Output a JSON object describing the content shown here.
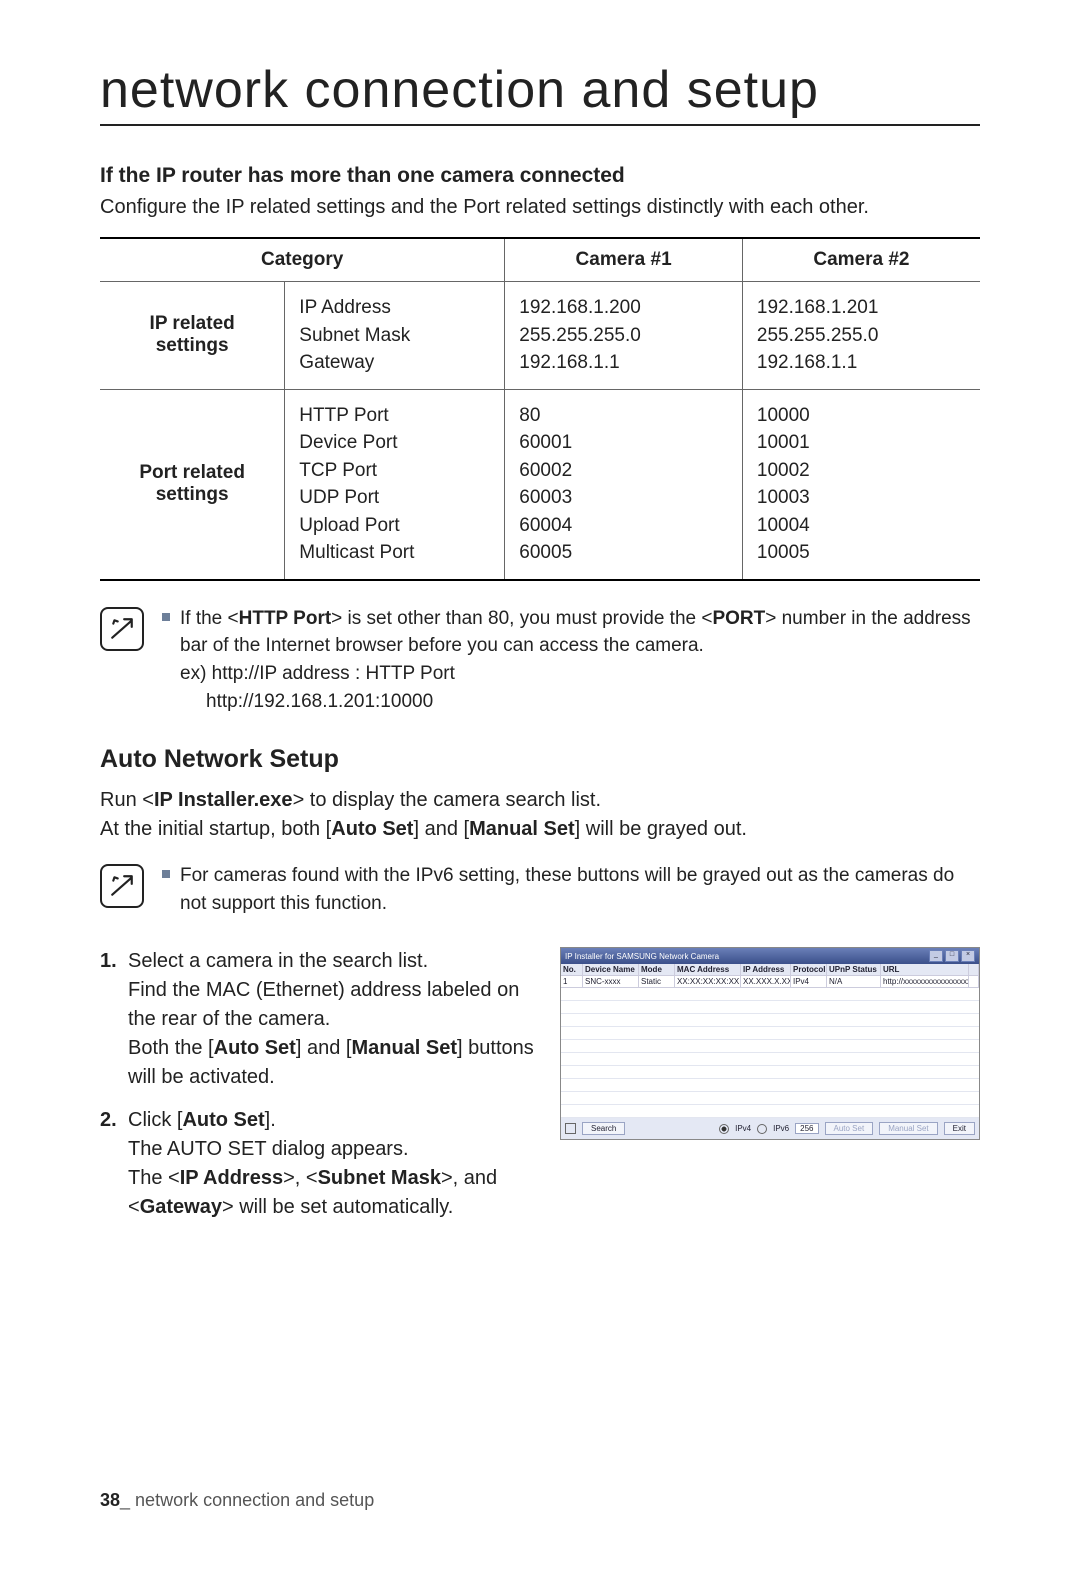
{
  "page_title": "network connection and setup",
  "section1": {
    "heading": "If the IP router has more than one camera connected",
    "intro": "Configure the IP related settings and the Port related settings distinctly with each other."
  },
  "table": {
    "headers": {
      "category": "Category",
      "cam1": "Camera #1",
      "cam2": "Camera #2"
    },
    "rows": [
      {
        "cat": "IP related settings",
        "labels": [
          "IP Address",
          "Subnet Mask",
          "Gateway"
        ],
        "cam1": [
          "192.168.1.200",
          "255.255.255.0",
          "192.168.1.1"
        ],
        "cam2": [
          "192.168.1.201",
          "255.255.255.0",
          "192.168.1.1"
        ]
      },
      {
        "cat": "Port related settings",
        "labels": [
          "HTTP Port",
          "Device Port",
          "TCP Port",
          "UDP Port",
          "Upload Port",
          "Multicast Port"
        ],
        "cam1": [
          "80",
          "60001",
          "60002",
          "60003",
          "60004",
          "60005"
        ],
        "cam2": [
          "10000",
          "10001",
          "10002",
          "10003",
          "10004",
          "10005"
        ]
      }
    ]
  },
  "note1": {
    "line1_a": "If the <",
    "line1_b": "HTTP Port",
    "line1_c": "> is set other than 80, you must provide the <",
    "line1_d": "PORT",
    "line1_e": "> number in the address bar of the Internet browser before you can access the camera.",
    "ex1": "ex) http://IP address : HTTP Port",
    "ex2": "http://192.168.1.201:10000"
  },
  "section2": {
    "heading": "Auto Network Setup",
    "body_a": "Run <",
    "body_b": "IP Installer.exe",
    "body_c": "> to display the camera search list.",
    "body2_a": "At the initial startup, both [",
    "body2_b": "Auto Set",
    "body2_c": "] and [",
    "body2_d": "Manual Set",
    "body2_e": "] will be grayed out."
  },
  "note2": "For cameras found with the IPv6 setting, these buttons will be grayed out as the cameras do not support this function.",
  "steps": [
    {
      "a": "Select a camera in the search list.",
      "b": "Find the MAC (Ethernet) address labeled on the rear of the camera.",
      "c_a": "Both the [",
      "c_b": "Auto Set",
      "c_c": "] and [",
      "c_d": "Manual Set",
      "c_e": "] buttons will be activated."
    },
    {
      "a_a": "Click [",
      "a_b": "Auto Set",
      "a_c": "].",
      "b": "The AUTO SET dialog appears.",
      "c_a": "The <",
      "c_b": "IP Address",
      "c_c": ">, <",
      "c_d": "Subnet Mask",
      "c_e": ">, and <",
      "c_f": "Gateway",
      "c_g": "> will be set automatically."
    }
  ],
  "screenshot": {
    "title": "IP Installer for SAMSUNG Network Camera",
    "cols": [
      "No.",
      "Device Name",
      "Mode",
      "MAC Address",
      "IP Address",
      "Protocol",
      "UPnP Status",
      "URL"
    ],
    "row1": [
      "1",
      "SNC-xxxx",
      "Static",
      "XX:XX:XX:XX:XX",
      "XX.XXX.X.XX",
      "IPv4",
      "N/A",
      "http://xxxxxxxxxxxxxxxxxxxxx"
    ],
    "search_btn": "Search",
    "ipv4": "IPv4",
    "ipv6": "IPv6",
    "count": "256",
    "autoset": "Auto Set",
    "manualset": "Manual Set",
    "exit": "Exit"
  },
  "footer": {
    "page": "38",
    "sep": "_ ",
    "label": "network connection and setup"
  }
}
